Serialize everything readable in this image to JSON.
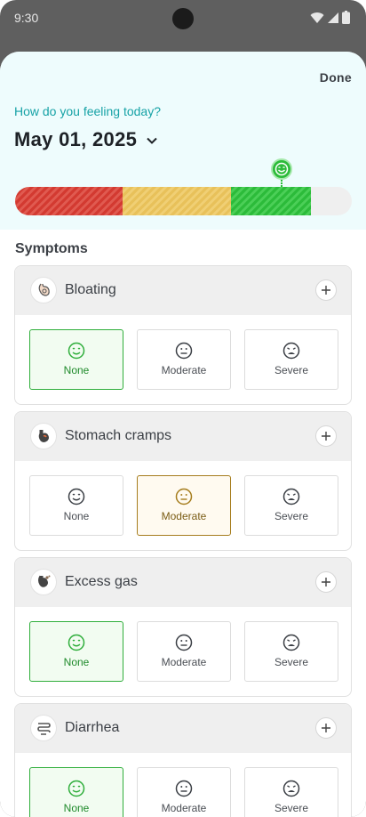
{
  "status_bar": {
    "time": "9:30"
  },
  "header": {
    "done_label": "Done",
    "question": "How do you feeling today?",
    "date": "May 01, 2025"
  },
  "mood_meter": {
    "segments": [
      {
        "level": "bad",
        "color": "#d33a31"
      },
      {
        "level": "moderate",
        "color": "#e8c15a"
      },
      {
        "level": "good",
        "color": "#2cbb3a"
      }
    ],
    "selected_level": "good",
    "selected_color": "#2cbb3a"
  },
  "symptoms": {
    "title": "Symptoms",
    "options": [
      "None",
      "Moderate",
      "Severe"
    ],
    "items": [
      {
        "name": "Bloating",
        "icon": "bloating-icon",
        "selected": "None"
      },
      {
        "name": "Stomach cramps",
        "icon": "stomach-icon",
        "selected": "Moderate"
      },
      {
        "name": "Excess gas",
        "icon": "gas-icon",
        "selected": "None"
      },
      {
        "name": "Diarrhea",
        "icon": "intestine-icon",
        "selected": "None"
      }
    ]
  },
  "colors": {
    "accent_teal": "#16a2a6",
    "selected_green": "#2fae3b",
    "selected_yellow": "#a67d1e"
  }
}
